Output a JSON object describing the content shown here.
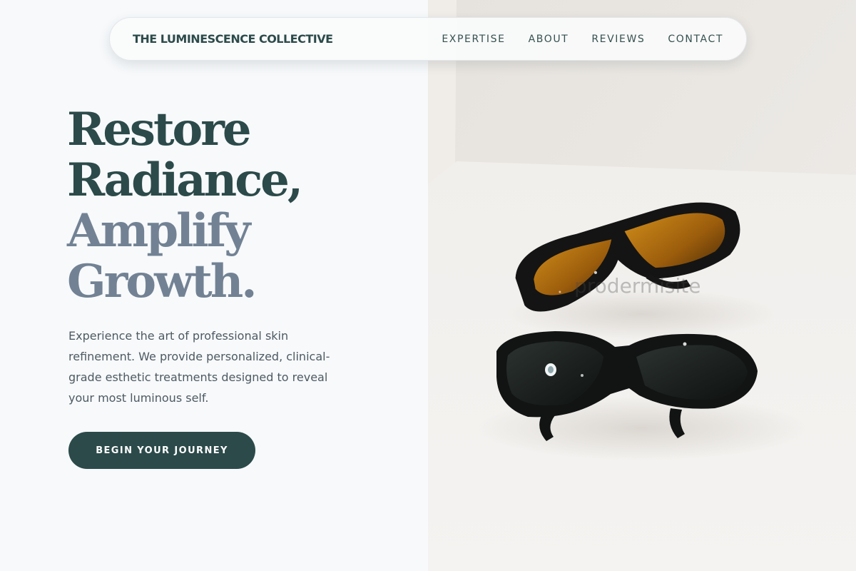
{
  "header": {
    "brand": "THE LUMINESCENCE COLLECTIVE",
    "nav": [
      {
        "label": "EXPERTISE"
      },
      {
        "label": "ABOUT"
      },
      {
        "label": "REVIEWS"
      },
      {
        "label": "CONTACT"
      }
    ]
  },
  "hero": {
    "headline": {
      "line1": "Restore",
      "line2": "Radiance,",
      "line3": "Amplify",
      "line4": "Growth."
    },
    "description": "Experience the art of professional skin refinement. We provide personalized, clinical-grade esthetic treatments designed to reveal your most luminous self.",
    "cta_label": "BEGIN YOUR JOURNEY",
    "image_watermark": "prodermisite"
  },
  "colors": {
    "primary": "#2c4a4a",
    "headline_muted": "#728294",
    "background": "#f7f9fb",
    "body_text": "#4d5a62",
    "lens_amber": "#b8720f"
  },
  "icons": {
    "hero_image": "safety-goggles-photo"
  }
}
